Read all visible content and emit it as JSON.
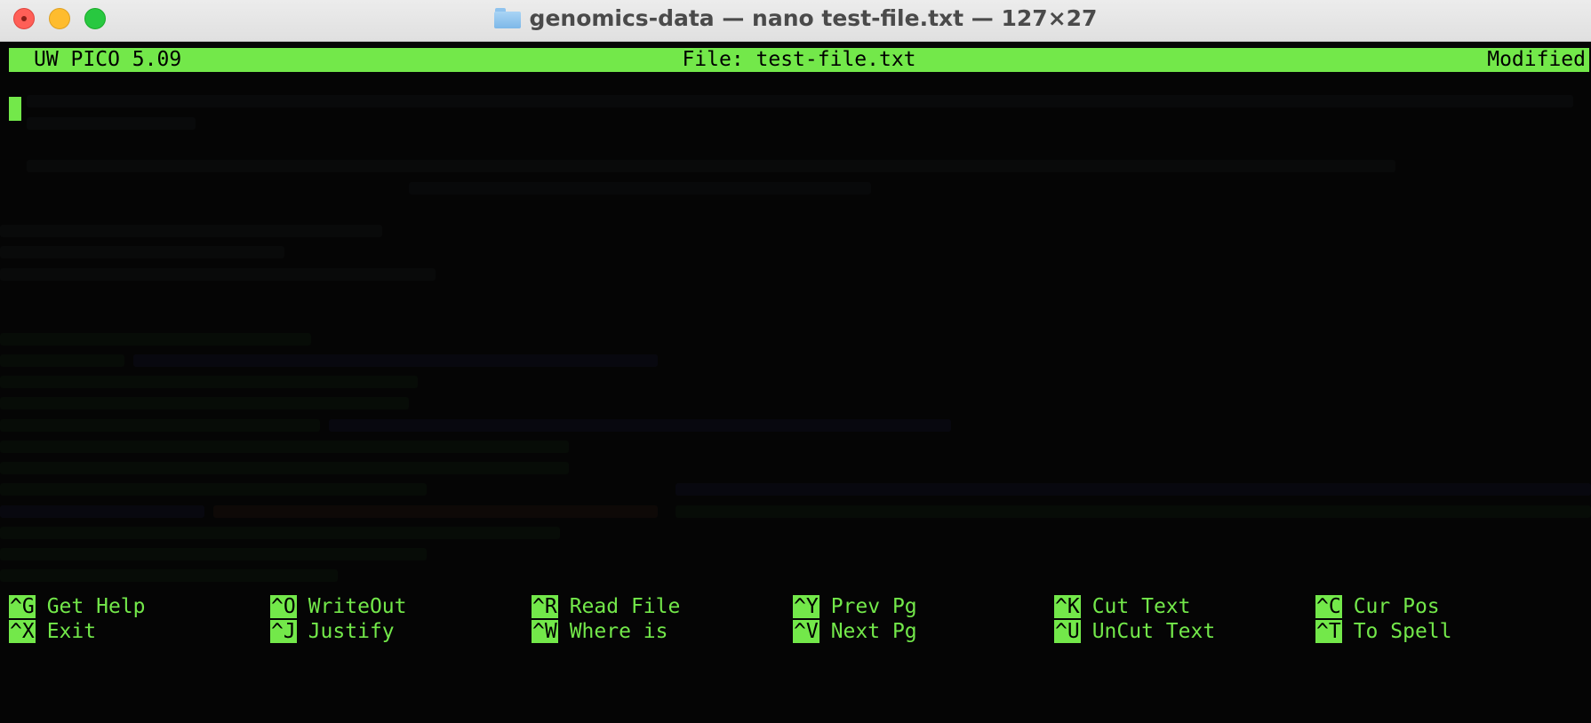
{
  "window": {
    "title": "genomics-data — nano test-file.txt — 127×27"
  },
  "editor": {
    "app_version": "UW PICO 5.09",
    "file_label": "File: test-file.txt",
    "status": "Modified"
  },
  "shortcuts": {
    "row1": [
      {
        "key": "^G",
        "label": "Get Help"
      },
      {
        "key": "^O",
        "label": "WriteOut"
      },
      {
        "key": "^R",
        "label": "Read File"
      },
      {
        "key": "^Y",
        "label": "Prev Pg"
      },
      {
        "key": "^K",
        "label": "Cut Text"
      },
      {
        "key": "^C",
        "label": "Cur Pos"
      }
    ],
    "row2": [
      {
        "key": "^X",
        "label": "Exit"
      },
      {
        "key": "^J",
        "label": "Justify"
      },
      {
        "key": "^W",
        "label": "Where is"
      },
      {
        "key": "^V",
        "label": "Next Pg"
      },
      {
        "key": "^U",
        "label": "UnCut Text"
      },
      {
        "key": "^T",
        "label": "To Spell"
      }
    ]
  },
  "colors": {
    "terminal_green": "#73e84a",
    "background": "#050505"
  }
}
